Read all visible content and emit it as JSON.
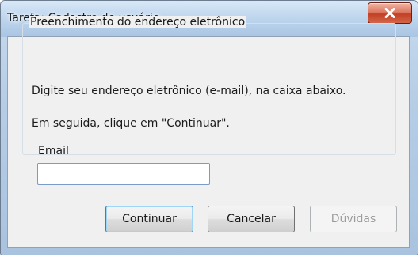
{
  "window": {
    "title": "Tarefa: Cadastro de usuário"
  },
  "group": {
    "legend": "Preenchimento do endereço eletrônico",
    "instruction_1": "Digite seu endereço eletrônico (e-mail), na caixa abaixo.",
    "instruction_2": "Em seguida, clique em \"Continuar\".",
    "email_label": "Email",
    "email_value": ""
  },
  "buttons": {
    "continue": "Continuar",
    "cancel": "Cancelar",
    "help": "Dúvidas",
    "help_enabled": false
  },
  "icons": {
    "close": "close-icon"
  },
  "colors": {
    "close_button": "#c24025",
    "title_bar": "#bfd6ee",
    "client_background": "#f0f0f0",
    "default_button_border": "#3c7fb1"
  }
}
